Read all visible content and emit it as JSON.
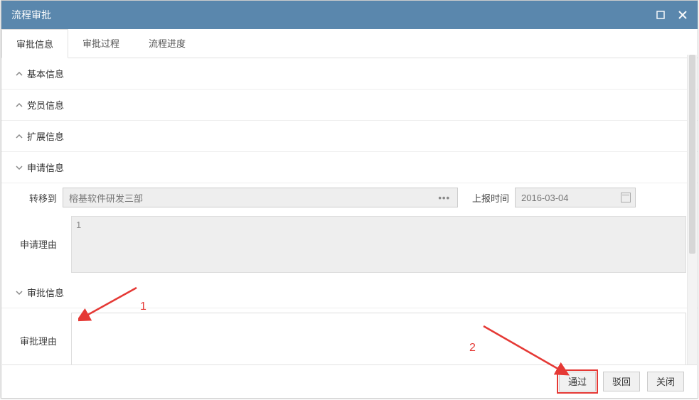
{
  "window": {
    "title": "流程审批"
  },
  "tabs": [
    {
      "label": "审批信息",
      "active": true
    },
    {
      "label": "审批过程",
      "active": false
    },
    {
      "label": "流程进度",
      "active": false
    }
  ],
  "sections": {
    "basic": {
      "title": "基本信息",
      "expanded": false
    },
    "member": {
      "title": "党员信息",
      "expanded": false
    },
    "ext": {
      "title": "扩展信息",
      "expanded": false
    },
    "apply": {
      "title": "申请信息",
      "expanded": true
    },
    "approve": {
      "title": "审批信息",
      "expanded": true
    }
  },
  "apply": {
    "transfer_to_label": "转移到",
    "transfer_to_value": "榕基软件研发三部",
    "report_time_label": "上报时间",
    "report_time_value": "2016-03-04",
    "reason_label": "申请理由",
    "reason_value": "1"
  },
  "approve": {
    "reason_label": "审批理由",
    "reason_value": ""
  },
  "footer": {
    "pass": "通过",
    "reject": "驳回",
    "close": "关闭"
  },
  "annotations": {
    "num1": "1",
    "num2": "2"
  }
}
